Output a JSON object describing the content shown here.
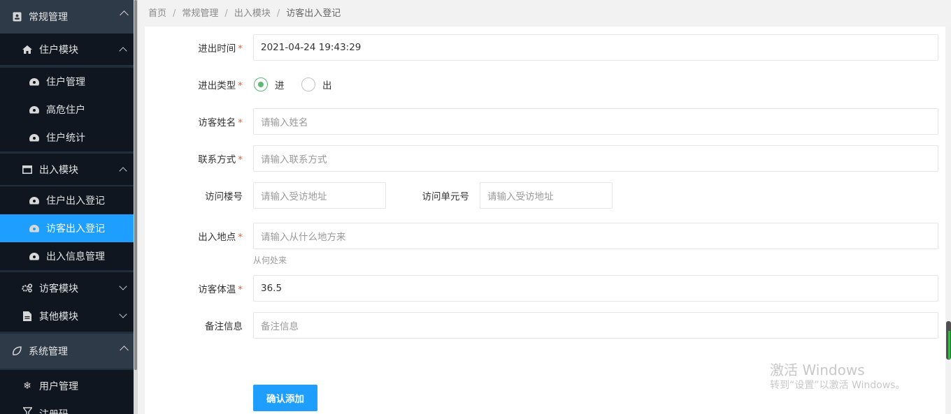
{
  "sidebar": {
    "groups": [
      {
        "label": "常规管理",
        "icon": "contact-card-icon"
      },
      {
        "label": "系统管理",
        "icon": "leaf-icon"
      }
    ],
    "submenus": [
      {
        "label": "住户模块",
        "icon": "home-icon"
      },
      {
        "label": "出入模块",
        "icon": "window-icon"
      },
      {
        "label": "访客模块",
        "icon": "gears-icon"
      },
      {
        "label": "其他模块",
        "icon": "file-icon"
      }
    ],
    "leaves": [
      {
        "label": "住户管理",
        "icon": "dashboard-icon"
      },
      {
        "label": "高危住户",
        "icon": "dashboard-icon"
      },
      {
        "label": "住户统计",
        "icon": "dashboard-icon"
      },
      {
        "label": "住户出入登记",
        "icon": "dashboard-icon"
      },
      {
        "label": "访客出入登记",
        "icon": "dashboard-icon",
        "active": true
      },
      {
        "label": "出入信息管理",
        "icon": "dashboard-icon"
      },
      {
        "label": "用户管理",
        "icon": "snowflake-icon"
      },
      {
        "label": "注册码",
        "icon": "filter-icon"
      }
    ]
  },
  "breadcrumb": [
    "首页",
    "常规管理",
    "出入模块",
    "访客出入登记"
  ],
  "breadcrumb_separator": "/",
  "form": {
    "time": {
      "label": "进出时间",
      "value": "2021-04-24 19:43:29"
    },
    "type": {
      "label": "进出类型",
      "options": [
        "进",
        "出"
      ],
      "selected": "进"
    },
    "name": {
      "label": "访客姓名",
      "placeholder": "请输入姓名"
    },
    "contact": {
      "label": "联系方式",
      "placeholder": "请输入联系方式"
    },
    "building": {
      "label": "访问楼号",
      "placeholder": "请输入受访地址"
    },
    "unit": {
      "label": "访问单元号",
      "placeholder": "请输入受访地址"
    },
    "origin": {
      "label": "出入地点",
      "placeholder": "请输入从什么地方来",
      "hint": "从何处来"
    },
    "temperature": {
      "label": "访客体温",
      "value": "36.5"
    },
    "remark": {
      "label": "备注信息",
      "placeholder": "备注信息"
    },
    "required_mark": "*",
    "submit_label": "确认添加"
  },
  "watermark": {
    "line1": "激活 Windows",
    "line2": "转到“设置”以激活 Windows。"
  },
  "colors": {
    "accent": "#1e9fff",
    "sidebar_bg": "#0f1620",
    "radio_on": "#5fb878",
    "required": "#ff5722"
  }
}
